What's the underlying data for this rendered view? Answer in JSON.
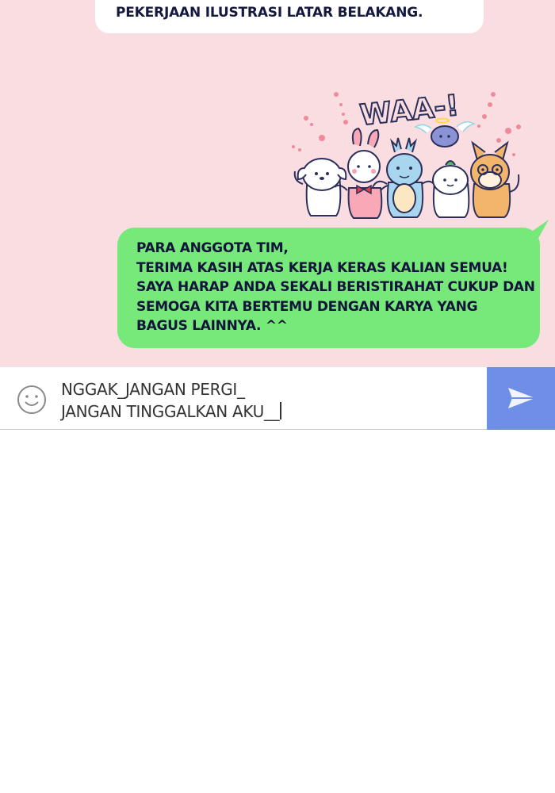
{
  "chat": {
    "background_color": "#f9dde0",
    "messages": [
      {
        "type": "incoming",
        "bubble_color": "#ffffff",
        "lines": [
          "PEKERJAAN ILUSTRASI LATAR BELAKANG."
        ]
      },
      {
        "type": "sticker",
        "icon": "team-mascots-waa-sticker",
        "text": "WAA-!"
      },
      {
        "type": "outgoing",
        "bubble_color": "#77e87a",
        "lines": [
          "PARA ANGGOTA TIM,",
          "TERIMA KASIH ATAS KERJA KERAS KALIAN SEMUA!",
          "SAYA HARAP ANDA SEKALI BERISTIRAHAT CUKUP DAN",
          "SEMOGA KITA BERTEMU DENGAN KARYA YANG",
          "BAGUS LAINNYA. ^^"
        ]
      }
    ]
  },
  "composer": {
    "emoji_icon": "smiley-icon",
    "draft_lines": [
      "NGGAK_JANGAN PERGI_",
      "JANGAN TINGGALKAN AKU__"
    ],
    "send_icon": "paper-plane-icon",
    "send_color": "#6f8fe6"
  }
}
